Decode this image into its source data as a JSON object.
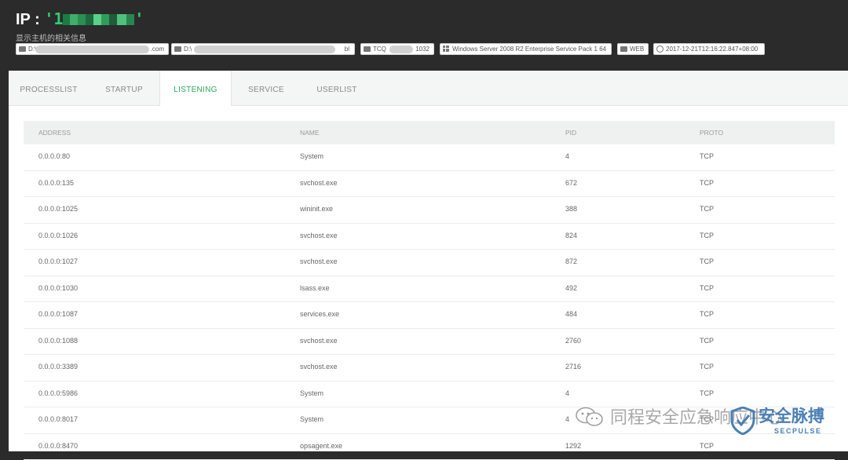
{
  "header": {
    "ip_label": "IP : ",
    "ip_value_prefix": "'1",
    "ip_value_suffix": "'",
    "subtitle": "显示主机的相关信息",
    "chips": [
      {
        "icon": "folder-icon",
        "text_start": "D:\\",
        "text_end": ".com"
      },
      {
        "icon": "folder-icon",
        "text_start": "D:\\",
        "text_end": "bl"
      },
      {
        "icon": "list-icon",
        "text_start": "TCQ",
        "text_end": "1032"
      },
      {
        "icon": "windows-icon",
        "text": "Windows Server 2008 R2 Enterprise Service Pack 1 64"
      },
      {
        "icon": "file-icon",
        "text": "WEB"
      },
      {
        "icon": "clock-icon",
        "text": "2017-12-21T12:16:22.847+08:00"
      }
    ]
  },
  "tabs": [
    {
      "label": "PROCESSLIST",
      "active": false
    },
    {
      "label": "STARTUP",
      "active": false
    },
    {
      "label": "LISTENING",
      "active": true
    },
    {
      "label": "SERVICE",
      "active": false
    },
    {
      "label": "USERLIST",
      "active": false
    }
  ],
  "table": {
    "columns": [
      "ADDRESS",
      "NAME",
      "PID",
      "PROTO"
    ],
    "rows": [
      [
        "0.0.0.0:80",
        "System",
        "4",
        "TCP"
      ],
      [
        "0.0.0.0:135",
        "svchost.exe",
        "672",
        "TCP"
      ],
      [
        "0.0.0.0:1025",
        "wininit.exe",
        "388",
        "TCP"
      ],
      [
        "0.0.0.0:1026",
        "svchost.exe",
        "824",
        "TCP"
      ],
      [
        "0.0.0.0:1027",
        "svchost.exe",
        "872",
        "TCP"
      ],
      [
        "0.0.0.0:1030",
        "lsass.exe",
        "492",
        "TCP"
      ],
      [
        "0.0.0.0:1087",
        "services.exe",
        "484",
        "TCP"
      ],
      [
        "0.0.0.0:1088",
        "svchost.exe",
        "2760",
        "TCP"
      ],
      [
        "0.0.0.0:3389",
        "svchost.exe",
        "2716",
        "TCP"
      ],
      [
        "0.0.0.0:5986",
        "System",
        "4",
        "TCP"
      ],
      [
        "0.0.0.0:8017",
        "System",
        "4",
        "TCP"
      ],
      [
        "0.0.0.0:8470",
        "opsagent.exe",
        "1292",
        "TCP"
      ]
    ]
  },
  "watermark": {
    "text": "同程安全应急响应中心",
    "logo_main": "安全脉搏",
    "logo_sub": "SECPULSE"
  },
  "colors": {
    "header_bg": "#2b2b2b",
    "ip_green": "#2ecc71",
    "active_tab": "#2ea65a",
    "logo_blue": "#4a7fb5"
  }
}
